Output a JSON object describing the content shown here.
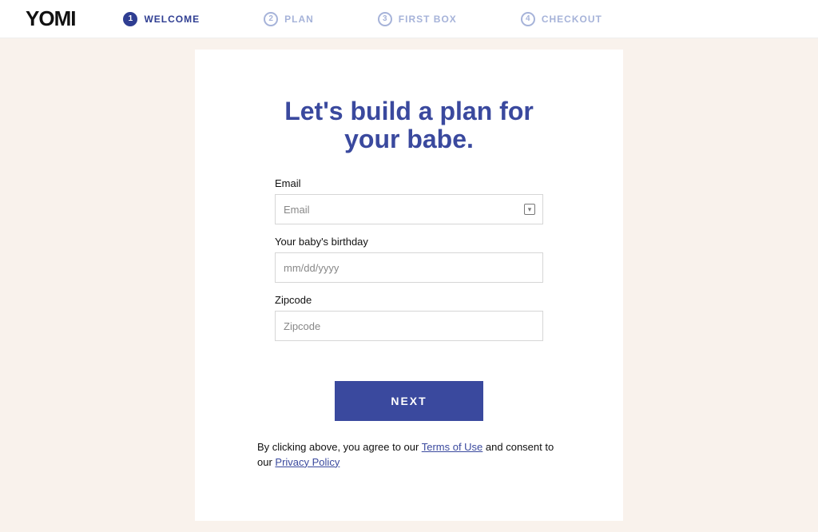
{
  "brand": {
    "logo_text": "YOMI"
  },
  "stepper": {
    "items": [
      {
        "num": "1",
        "label": "WELCOME",
        "active": true
      },
      {
        "num": "2",
        "label": "PLAN",
        "active": false
      },
      {
        "num": "3",
        "label": "FIRST BOX",
        "active": false
      },
      {
        "num": "4",
        "label": "CHECKOUT",
        "active": false
      }
    ]
  },
  "card": {
    "headline": "Let's build a plan for your babe.",
    "fields": {
      "email": {
        "label": "Email",
        "placeholder": "Email"
      },
      "birthday": {
        "label": "Your baby's birthday",
        "placeholder": "mm/dd/yyyy"
      },
      "zipcode": {
        "label": "Zipcode",
        "placeholder": "Zipcode"
      }
    },
    "next_button": "NEXT",
    "consent": {
      "pre": "By clicking above, you agree to our ",
      "tos": "Terms of Use",
      "mid": " and consent to our ",
      "priv": "Privacy Policy"
    }
  }
}
